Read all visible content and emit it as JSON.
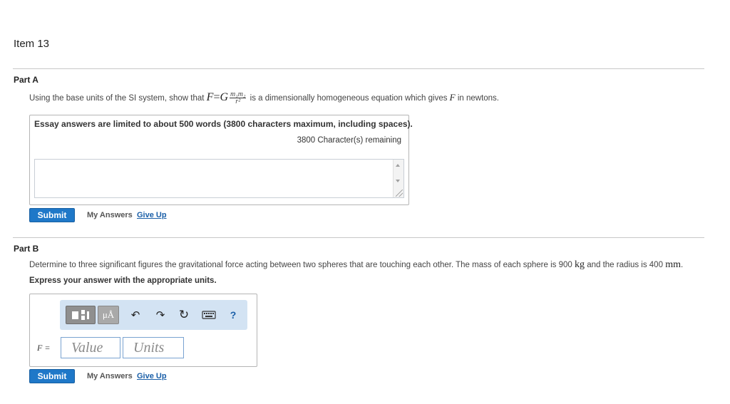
{
  "item": {
    "title": "Item 13"
  },
  "partA": {
    "label": "Part A",
    "question_prefix": "Using the base units of the SI system, show that",
    "formula": {
      "lhs": "F",
      "eq": "=",
      "g": "G",
      "num": "m₁m₂",
      "den": "r²"
    },
    "question_mid": "is a dimensionally homogeneous equation which gives",
    "question_var": "F",
    "question_suffix": "in newtons.",
    "essay_notice": "Essay answers are limited to about 500 words (3800 characters maximum, including spaces).",
    "chars_remaining": "3800 Character(s) remaining",
    "submit_label": "Submit",
    "my_answers_label": "My Answers",
    "give_up_label": "Give Up"
  },
  "partB": {
    "label": "Part B",
    "question_prefix": "Determine to three significant figures the gravitational force acting between two spheres that are touching each other. The mass of each sphere is 900",
    "mass_unit": "kg",
    "question_mid": "and the radius is 400",
    "radius_unit": "mm",
    "question_end": ".",
    "instruction": "Express your answer with the appropriate units.",
    "toolbar": {
      "mu_label": "μÅ",
      "undo_glyph": "↶",
      "redo_glyph": "↷",
      "reset_glyph": "↻",
      "help_label": "?"
    },
    "f_label": "F =",
    "value_placeholder": "Value",
    "units_placeholder": "Units",
    "submit_label": "Submit",
    "my_answers_label": "My Answers",
    "give_up_label": "Give Up"
  },
  "colors": {
    "submit_bg": "#1f78c8",
    "toolbar_bg": "#d3e3f3",
    "link": "#1a5fa8"
  },
  "icons": [
    "grid-template-icon",
    "units-icon",
    "undo-icon",
    "redo-icon",
    "reset-icon",
    "keyboard-icon",
    "help-icon"
  ]
}
